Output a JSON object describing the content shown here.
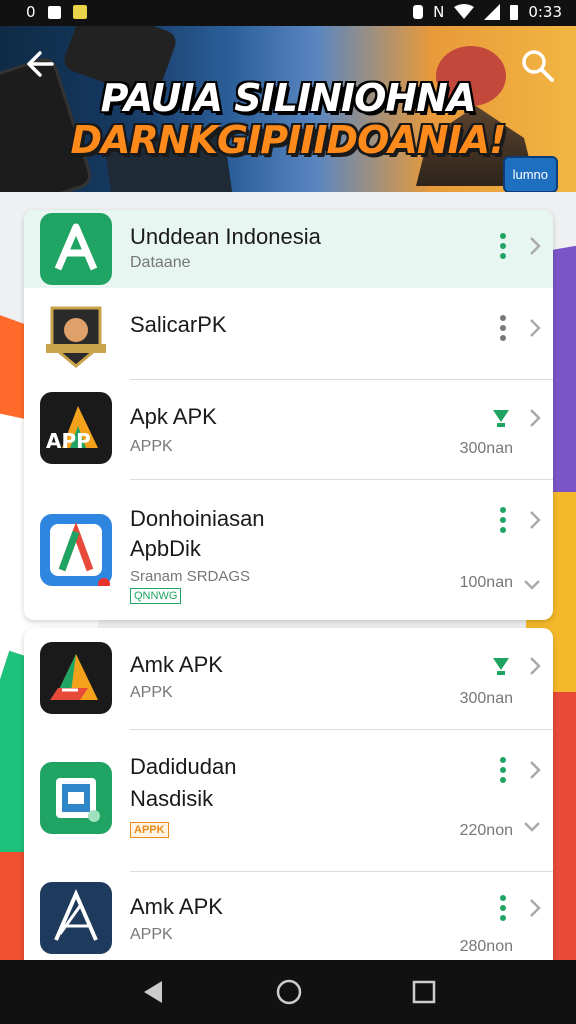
{
  "status_bar": {
    "left_text": "0",
    "time": "0:33",
    "indicator": "N"
  },
  "hero": {
    "title_line1": "PAUIA SILINIOHNA",
    "title_line2": "DARNKGIPIIIDOANIA!",
    "badge_text": "lumno"
  },
  "list_top": [
    {
      "title": "Unddean Indonesia",
      "subtitle": "Dataane",
      "icon": "green-a-logo-icon",
      "action": "kebab",
      "highlighted": true
    },
    {
      "title": "SalicarPK",
      "subtitle": "",
      "icon": "mascot-badge-icon",
      "action": "kebab",
      "highlighted": false
    },
    {
      "title": "Apk APK",
      "subtitle": "APPK",
      "meta": "300nan",
      "icon": "apk-a-logo-icon",
      "action": "download"
    },
    {
      "title_line1": "Donhoiniasan",
      "title_line2": "ApbDik",
      "subtitle": "Sranam SRDAGS",
      "tag": "QNNWG",
      "meta": "100nan",
      "icon": "blue-a-logo-icon",
      "action": "kebab",
      "expand": true
    }
  ],
  "list_bottom": [
    {
      "title": "Amk APK",
      "subtitle": "APPK",
      "meta": "300nan",
      "icon": "tri-color-a-logo-icon",
      "action": "download"
    },
    {
      "title_line1": "Dadidudan",
      "title_line2": "Nasdisik",
      "tag": "APPK",
      "meta": "220non",
      "icon": "green-square-app-icon",
      "action": "kebab",
      "expand": true
    },
    {
      "title": "Amk APK",
      "subtitle": "APPK",
      "meta": "280non",
      "icon": "navy-a-logo-icon",
      "action": "kebab"
    }
  ],
  "colors": {
    "accent_green": "#1fa463",
    "hero_orange": "#ff8a1c",
    "highlight_row": "#e8f6f1"
  }
}
